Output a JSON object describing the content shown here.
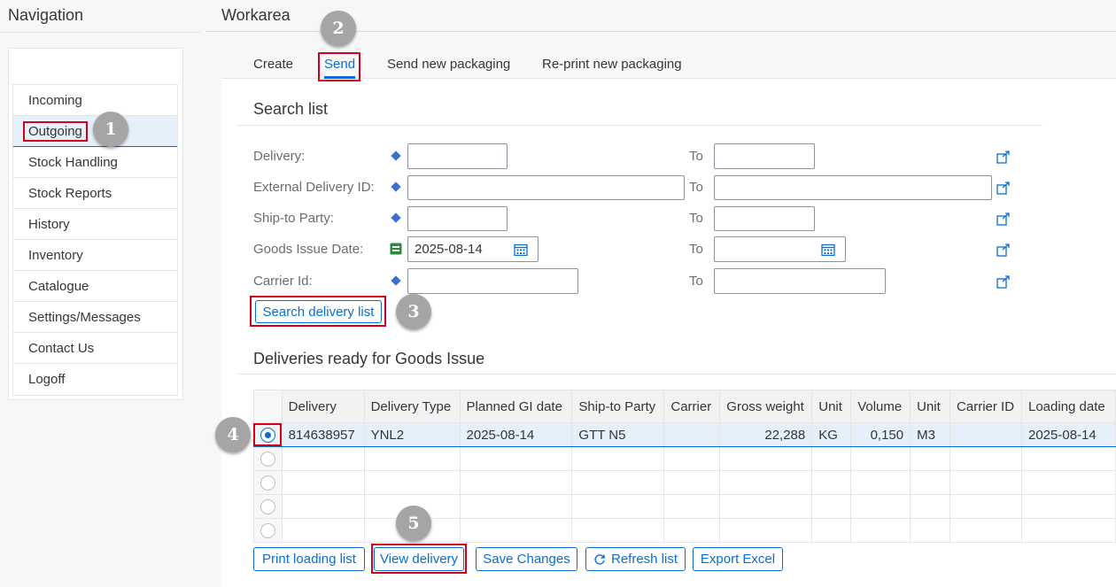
{
  "navigation": {
    "title": "Navigation",
    "items": [
      {
        "label": "Incoming"
      },
      {
        "label": "Outgoing",
        "selected": true
      },
      {
        "label": "Stock Handling"
      },
      {
        "label": "Stock Reports"
      },
      {
        "label": "History"
      },
      {
        "label": "Inventory"
      },
      {
        "label": "Catalogue"
      },
      {
        "label": "Settings/Messages"
      },
      {
        "label": "Contact Us"
      },
      {
        "label": "Logoff"
      }
    ]
  },
  "workarea": {
    "title": "Workarea",
    "tabs": [
      {
        "label": "Create"
      },
      {
        "label": "Send",
        "active": true
      },
      {
        "label": "Send new packaging"
      },
      {
        "label": "Re-print new packaging"
      }
    ]
  },
  "search": {
    "title": "Search list",
    "to_label": "To",
    "fields": [
      {
        "label": "Delivery:",
        "from": "",
        "to": ""
      },
      {
        "label": "External Delivery ID:",
        "from": "",
        "to": ""
      },
      {
        "label": "Ship-to Party:",
        "from": "",
        "to": ""
      },
      {
        "label": "Goods Issue Date:",
        "from": "2025-08-14",
        "to": ""
      },
      {
        "label": "Carrier Id:",
        "from": "",
        "to": ""
      }
    ],
    "button_label": "Search delivery list"
  },
  "deliveries": {
    "title": "Deliveries ready for Goods Issue",
    "columns": [
      "Delivery",
      "Delivery Type",
      "Planned GI date",
      "Ship-to Party",
      "Carrier",
      "Gross weight",
      "Unit",
      "Volume",
      "Unit",
      "Carrier ID",
      "Loading date"
    ],
    "rows": [
      [
        "814638957",
        "YNL2",
        "2025-08-14",
        "GTT N5",
        "",
        "22,288",
        "KG",
        "0,150",
        "M3",
        "",
        "2025-08-14"
      ]
    ]
  },
  "actions": {
    "print_loading_list": "Print loading list",
    "view_delivery": "View delivery",
    "save_changes": "Save Changes",
    "refresh_list": "Refresh list",
    "export_excel": "Export Excel"
  },
  "callouts": [
    "1",
    "2",
    "3",
    "4",
    "5"
  ],
  "colors": {
    "accent": "#0a6ed1",
    "highlight": "#d0021b",
    "selected_row": "#e5f0fa",
    "callout": "#a5a5a5"
  },
  "icons": {
    "required": "diamond-icon",
    "date_required": "calendar-green-icon",
    "date_picker": "calendar-icon",
    "multi_select": "multiple-selection-icon",
    "refresh": "refresh-icon"
  }
}
